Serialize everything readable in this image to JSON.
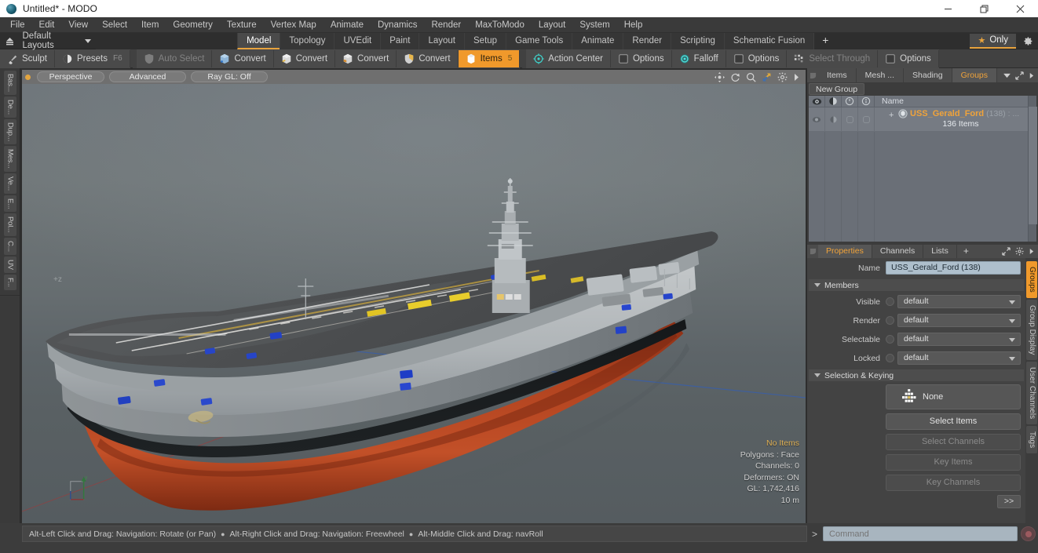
{
  "window": {
    "title": "Untitled* - MODO",
    "logo_icon": "modo-logo-icon",
    "minimize_label": "minimize-icon",
    "maximize_label": "restore-icon",
    "close_label": "close-icon"
  },
  "menubar": {
    "items": [
      {
        "label": "File"
      },
      {
        "label": "Edit"
      },
      {
        "label": "View"
      },
      {
        "label": "Select"
      },
      {
        "label": "Item"
      },
      {
        "label": "Geometry"
      },
      {
        "label": "Texture"
      },
      {
        "label": "Vertex Map"
      },
      {
        "label": "Animate"
      },
      {
        "label": "Dynamics"
      },
      {
        "label": "Render"
      },
      {
        "label": "MaxToModo"
      },
      {
        "label": "Layout"
      },
      {
        "label": "System"
      },
      {
        "label": "Help"
      }
    ]
  },
  "layoutbar": {
    "home_icon": "home-layout-icon",
    "selector_label": "Default Layouts",
    "caret_icon": "chevron-down-icon",
    "tabs": [
      {
        "label": "Model",
        "active": true
      },
      {
        "label": "Topology",
        "active": false
      },
      {
        "label": "UVEdit",
        "active": false
      },
      {
        "label": "Paint",
        "active": false
      },
      {
        "label": "Layout",
        "active": false
      },
      {
        "label": "Setup",
        "active": false
      },
      {
        "label": "Game Tools",
        "active": false
      },
      {
        "label": "Animate",
        "active": false
      },
      {
        "label": "Render",
        "active": false
      },
      {
        "label": "Scripting",
        "active": false
      },
      {
        "label": "Schematic Fusion",
        "active": false
      }
    ],
    "add_tab_label": "+",
    "only_label": "Only",
    "star_icon": "star-icon",
    "gear_icon": "gear-icon"
  },
  "toolbar": {
    "groups": [
      {
        "items": [
          {
            "label": "Sculpt",
            "icon": "brush-icon",
            "state": "normal",
            "kbd": ""
          },
          {
            "label": "Presets",
            "icon": "sphere-icon",
            "state": "normal",
            "kbd": "F6"
          }
        ]
      },
      {
        "items": [
          {
            "label": "Auto Select",
            "icon": "shield-grey-icon",
            "state": "dim",
            "kbd": ""
          },
          {
            "label": "Convert",
            "icon": "convert-blue-icon",
            "state": "normal",
            "kbd": ""
          },
          {
            "label": "Convert",
            "icon": "convert-yellow-icon",
            "state": "normal",
            "kbd": ""
          },
          {
            "label": "Convert",
            "icon": "convert-orange-icon",
            "state": "normal",
            "kbd": ""
          },
          {
            "label": "Convert",
            "icon": "convert-shield-icon",
            "state": "normal",
            "kbd": ""
          },
          {
            "label": "Items",
            "icon": "items-icon",
            "state": "active",
            "kbd": "5"
          }
        ]
      },
      {
        "items": [
          {
            "label": "Action Center",
            "icon": "action-center-icon",
            "state": "normal",
            "kbd": ""
          },
          {
            "label": "Options",
            "icon": "options-square-icon",
            "state": "normal",
            "kbd": ""
          },
          {
            "label": "Falloff",
            "icon": "falloff-icon",
            "state": "normal",
            "kbd": ""
          },
          {
            "label": "Options",
            "icon": "options-square-icon",
            "state": "normal",
            "kbd": ""
          },
          {
            "label": "Select Through",
            "icon": "select-through-icon",
            "state": "dim",
            "kbd": ""
          },
          {
            "label": "Options",
            "icon": "options-square-icon",
            "state": "normal",
            "kbd": ""
          }
        ]
      }
    ]
  },
  "left_strip": {
    "tabs": [
      {
        "label": "Bas..."
      },
      {
        "label": "De..."
      },
      {
        "label": "Dup..."
      },
      {
        "label": "Mes..."
      },
      {
        "label": "Ve..."
      },
      {
        "label": "E..."
      },
      {
        "label": "Pol..."
      },
      {
        "label": "C..."
      },
      {
        "label": "UV"
      },
      {
        "label": "F..."
      }
    ]
  },
  "viewport": {
    "dot_icon": "viewport-active-dot-icon",
    "pills": [
      {
        "label": "Perspective"
      },
      {
        "label": "Advanced"
      },
      {
        "label": "Ray GL: Off"
      }
    ],
    "nav_icons": [
      {
        "name": "pan-icon"
      },
      {
        "name": "rotate-icon"
      },
      {
        "name": "zoom-icon"
      },
      {
        "name": "fit-icon"
      },
      {
        "name": "gear-icon"
      },
      {
        "name": "chevron-right-icon"
      }
    ],
    "z_label": "+z",
    "axis_gizmo_icon": "axis-gizmo-icon",
    "stats": {
      "selection": "No Items",
      "polygons": "Polygons : Face",
      "channels": "Channels: 0",
      "deformers": "Deformers: ON",
      "gl": "GL: 1,742,416",
      "scale": "10 m"
    },
    "model_name": "USS Gerald Ford aircraft carrier 3D model"
  },
  "right_panel": {
    "top_tabs": [
      {
        "label": "Items",
        "active": false
      },
      {
        "label": "Mesh ...",
        "active": false
      },
      {
        "label": "Shading",
        "active": false
      },
      {
        "label": "Groups",
        "active": true
      }
    ],
    "top_tab_caret": "chevron-down-icon",
    "expand_icon": "expand-icon",
    "more_icon": "chevron-right-icon",
    "new_group_label": "New Group",
    "list": {
      "col_icons": [
        "eye-icon",
        "render-icon",
        "lock-icon",
        "select-icon"
      ],
      "name_header": "Name",
      "rows": [
        {
          "expand_icon": "plus-expand-icon",
          "group_icon": "group-icon",
          "name": "USS_Gerald_Ford",
          "count": "(138) : ...",
          "sub": "136 Items"
        }
      ]
    },
    "properties": {
      "tabs": [
        {
          "label": "Properties",
          "active": true
        },
        {
          "label": "Channels",
          "active": false
        },
        {
          "label": "Lists",
          "active": false
        }
      ],
      "add_label": "+",
      "expand_icon": "expand-icon",
      "gear_icon": "gear-icon",
      "more_icon": "chevron-right-icon",
      "name_label": "Name",
      "name_value": "USS_Gerald_Ford (138)",
      "members_section": "Members",
      "fields": [
        {
          "label": "Visible",
          "value": "default"
        },
        {
          "label": "Render",
          "value": "default"
        },
        {
          "label": "Selectable",
          "value": "default"
        },
        {
          "label": "Locked",
          "value": "default"
        }
      ],
      "selection_section": "Selection & Keying",
      "none_button": "None",
      "none_icon": "keyframe-grid-icon",
      "buttons": [
        {
          "label": "Select Items",
          "enabled": true
        },
        {
          "label": "Select Channels",
          "enabled": false
        },
        {
          "label": "Key Items",
          "enabled": false
        },
        {
          "label": "Key Channels",
          "enabled": false
        }
      ],
      "more_button": ">>"
    },
    "side_tabs": [
      {
        "label": "Groups",
        "active": true
      },
      {
        "label": "Group Display",
        "active": false
      },
      {
        "label": "User Channels",
        "active": false
      },
      {
        "label": "Tags",
        "active": false
      }
    ]
  },
  "statusbar": {
    "hints": [
      "Alt-Left Click and Drag: Navigation: Rotate (or Pan)",
      "Alt-Right Click and Drag: Navigation: Freewheel",
      "Alt-Middle Click and Drag: navRoll"
    ],
    "separator": "●",
    "command_prompt": ">",
    "command_placeholder": "Command",
    "record_icon": "record-icon"
  },
  "colors": {
    "accent_orange": "#f0992b",
    "panel_bg": "#3c3c3c",
    "list_bg": "#6a6f77",
    "field_blue": "#aebfcc",
    "hull_red": "#a8391a",
    "deck_grey": "#5c5c5c"
  }
}
